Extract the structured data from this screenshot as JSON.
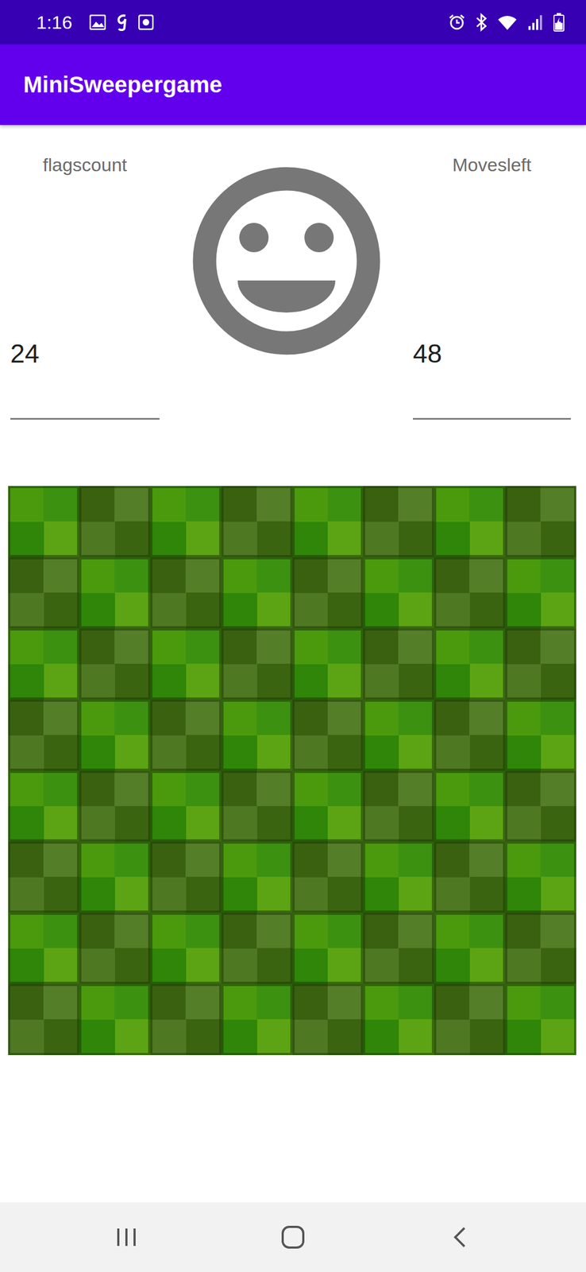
{
  "status_bar": {
    "time": "1:16"
  },
  "app_bar": {
    "title": "MiniSweepergame"
  },
  "flags": {
    "label": "flagscount",
    "value": "24"
  },
  "moves": {
    "label": "Movesleft",
    "value": "48"
  },
  "board": {
    "rows": [
      [
        {
          "covered": true
        },
        {
          "covered": true
        },
        {
          "covered": true
        },
        {
          "covered": true
        },
        {
          "covered": true
        },
        {
          "covered": true
        },
        {
          "covered": true
        },
        {
          "covered": true
        }
      ],
      [
        {
          "covered": true
        },
        {
          "covered": true
        },
        {
          "covered": true
        },
        {
          "covered": true
        },
        {
          "covered": true
        },
        {
          "covered": true
        },
        {
          "covered": true
        },
        {
          "covered": true
        }
      ],
      [
        {
          "covered": true
        },
        {
          "covered": true
        },
        {
          "covered": true
        },
        {
          "covered": true
        },
        {
          "covered": true
        },
        {
          "covered": true
        },
        {
          "covered": true
        },
        {
          "covered": true
        }
      ],
      [
        {
          "covered": true
        },
        {
          "covered": true
        },
        {
          "covered": true
        },
        {
          "covered": true
        },
        {
          "covered": true
        },
        {
          "covered": true
        },
        {
          "covered": true
        },
        {
          "covered": true
        }
      ],
      [
        {
          "covered": true
        },
        {
          "covered": true
        },
        {
          "covered": true
        },
        {
          "covered": true
        },
        {
          "covered": true
        },
        {
          "covered": true
        },
        {
          "covered": true
        },
        {
          "covered": true
        }
      ],
      [
        {
          "covered": true
        },
        {
          "covered": true
        },
        {
          "covered": true
        },
        {
          "covered": true
        },
        {
          "covered": true
        },
        {
          "covered": true
        },
        {
          "covered": true
        },
        {
          "covered": true
        }
      ],
      [
        {
          "covered": true
        },
        {
          "covered": true
        },
        {
          "covered": true
        },
        {
          "covered": true
        },
        {
          "covered": true
        },
        {
          "covered": true
        },
        {
          "covered": true
        },
        {
          "covered": true
        }
      ],
      [
        {
          "covered": true
        },
        {
          "covered": true
        },
        {
          "covered": true
        },
        {
          "covered": true
        },
        {
          "covered": true
        },
        {
          "covered": true
        },
        {
          "covered": true
        },
        {
          "covered": true
        }
      ]
    ]
  }
}
